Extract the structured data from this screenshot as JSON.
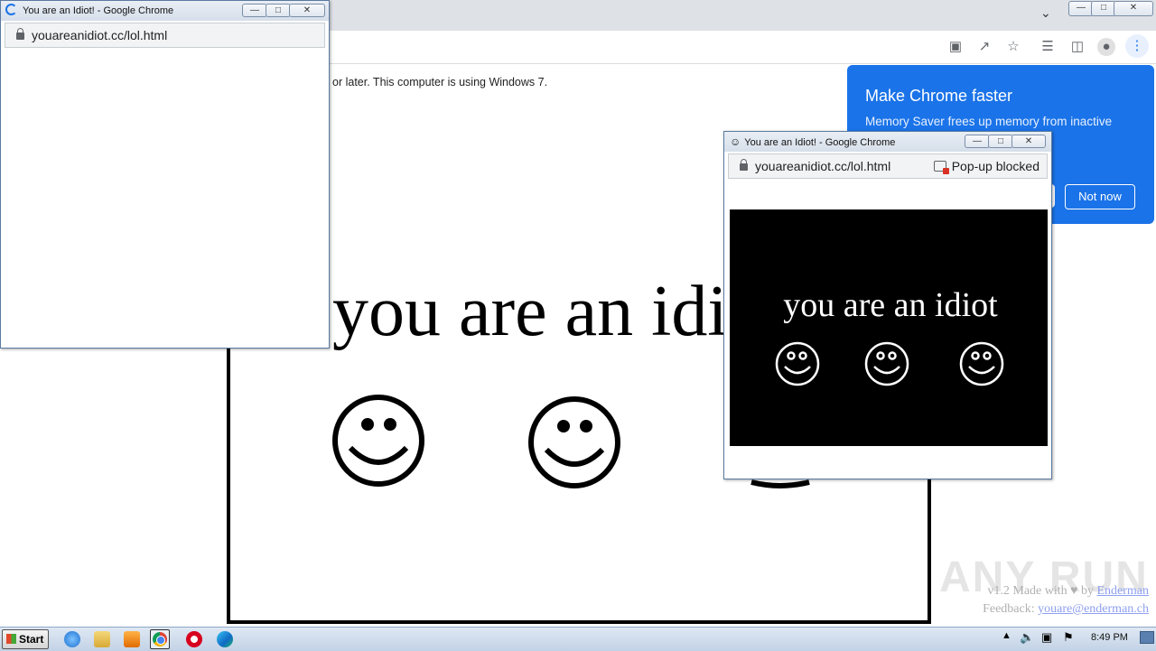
{
  "main_window": {
    "warning_text": "or later. This computer is using Windows 7.",
    "idiot_text": "you are an idiot"
  },
  "popup_left": {
    "title": "You are an Idiot! - Google Chrome",
    "url": "youareanidiot.cc/lol.html"
  },
  "popup_right": {
    "title": "You are an Idiot! - Google Chrome",
    "url": "youareanidiot.cc/lol.html",
    "blocked_label": "Pop-up blocked",
    "message": "you are an idiot"
  },
  "chrome_bubble": {
    "title": "Make Chrome faster",
    "body": "Memory Saver frees up memory from inactive tabs and other",
    "not_now": "Not now"
  },
  "footer": {
    "prefix": "v1.2 Made with ",
    "by": " by ",
    "author": "Enderman",
    "feedback_label": "Feedback: ",
    "email": "youare@enderman.ch"
  },
  "watermark": "ANY RUN",
  "taskbar": {
    "start_label": "Start",
    "clock": "8:49 PM",
    "icons": [
      "ie-icon",
      "folder-icon",
      "media-player-icon",
      "chrome-icon",
      "opera-icon",
      "edge-icon"
    ]
  },
  "colors": {
    "chrome_blue": "#1a73e8",
    "taskbar": "#c2d2e6"
  }
}
